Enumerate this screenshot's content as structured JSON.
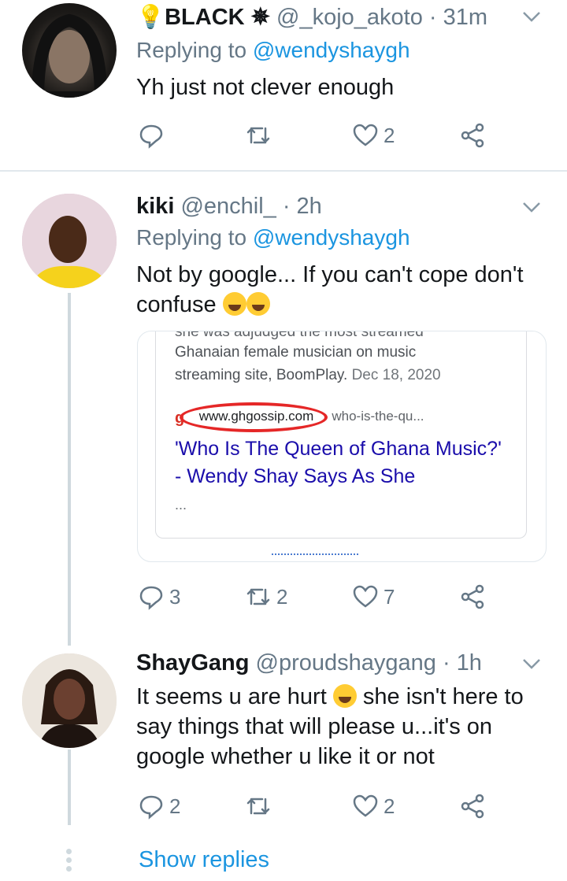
{
  "tweets": [
    {
      "name": "💡BLACK ✵",
      "handle": "@_kojo_akoto · 31m",
      "replying_prefix": "Replying to ",
      "replying_to": "@wendyshaygh",
      "text": "Yh just not clever enough",
      "counts": {
        "reply": "",
        "retweet": "",
        "like": "2"
      }
    },
    {
      "name": "kiki",
      "handle": "@enchil_ · 2h",
      "replying_prefix": "Replying to ",
      "replying_to": "@wendyshaygh",
      "text_line1": "Not by google... If you can't cope don't",
      "text_line2": "confuse",
      "counts": {
        "reply": "3",
        "retweet": "2",
        "like": "7"
      },
      "card": {
        "snippet_cut": "she was adjudged the most streamed",
        "snippet_line1": "Ghanaian female musician on music",
        "snippet_line2": "streaming site, BoomPlay.",
        "snippet_date": "Dec 18, 2020",
        "site": "www.ghgossip.com",
        "path": "› who-is-the-qu...",
        "title": "'Who Is The Queen of Ghana Music?' - Wendy Shay Says As She",
        "more": "..."
      }
    },
    {
      "name": "ShayGang",
      "handle": "@proudshaygang · 1h",
      "text_line1_a": "It seems u are hurt",
      "text_line1_b": "she isn't here to",
      "text_line2": "say things that will please u...it's on",
      "text_line3": "google whether u like it or not",
      "counts": {
        "reply": "2",
        "retweet": "",
        "like": "2"
      }
    }
  ],
  "show_replies": "Show replies",
  "colors": {
    "link": "#1b95e0",
    "muted": "#657786",
    "google_link": "#1a0dab",
    "annotation": "#e52727"
  }
}
